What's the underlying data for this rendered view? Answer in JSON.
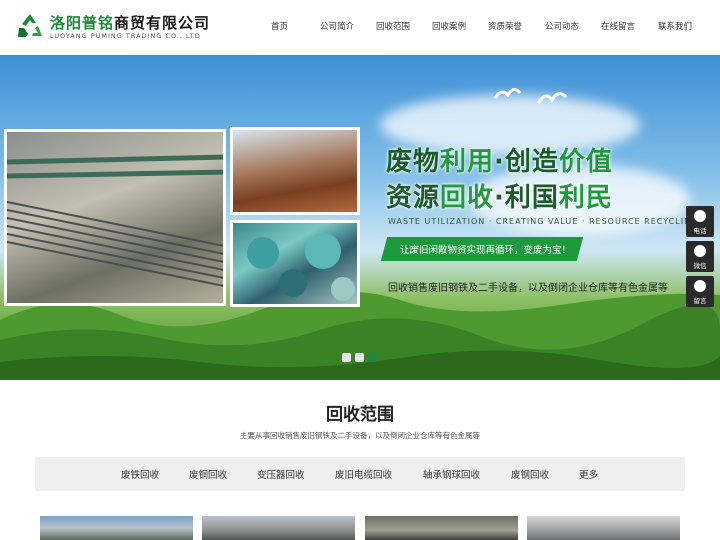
{
  "header": {
    "logo_cn_part1": "洛阳",
    "logo_cn_part2": "普铭",
    "logo_cn_part3": "商贸有限公司",
    "logo_en": "LUOYANG PUMING TRADING CO., LTD",
    "nav": [
      "首页",
      "公司简介",
      "回收范围",
      "回收案例",
      "资质荣誉",
      "公司动态",
      "在线留言",
      "联系我们"
    ]
  },
  "banner": {
    "slogan_1_a": "废物",
    "slogan_1_b": "利用",
    "slogan_1_c": "·创造",
    "slogan_1_d": "价值",
    "slogan_2_a": "资源",
    "slogan_2_b": "回收",
    "slogan_2_c": "·利国",
    "slogan_2_d": "利民",
    "slogan_en": "WASTE UTILIZATION · CREATING VALUE · RESOURCE RECYCLING",
    "tagline": "让废旧闲散物资实现再循环，变废为宝！",
    "description": "回收销售废旧钢铁及二手设备，以及倒闭企业仓库等有色金属等",
    "slide_count": 3,
    "active_slide": 3
  },
  "side_float": [
    "电话",
    "微信",
    "留言"
  ],
  "section": {
    "title": "回收范围",
    "subtitle": "主要从事回收销售废旧钢铁及二手设备，以及倒闭企业仓库等有色金属等",
    "tabs": [
      "废铁回收",
      "废铜回收",
      "变压器回收",
      "废旧电缆回收",
      "轴承钢球回收",
      "废钢回收",
      "更多"
    ]
  },
  "colors": {
    "brand_green": "#1f8a3a",
    "slogan_green": "#1a5c2a",
    "tab_bg": "#efefef",
    "side_bg": "#2a2a2a"
  }
}
